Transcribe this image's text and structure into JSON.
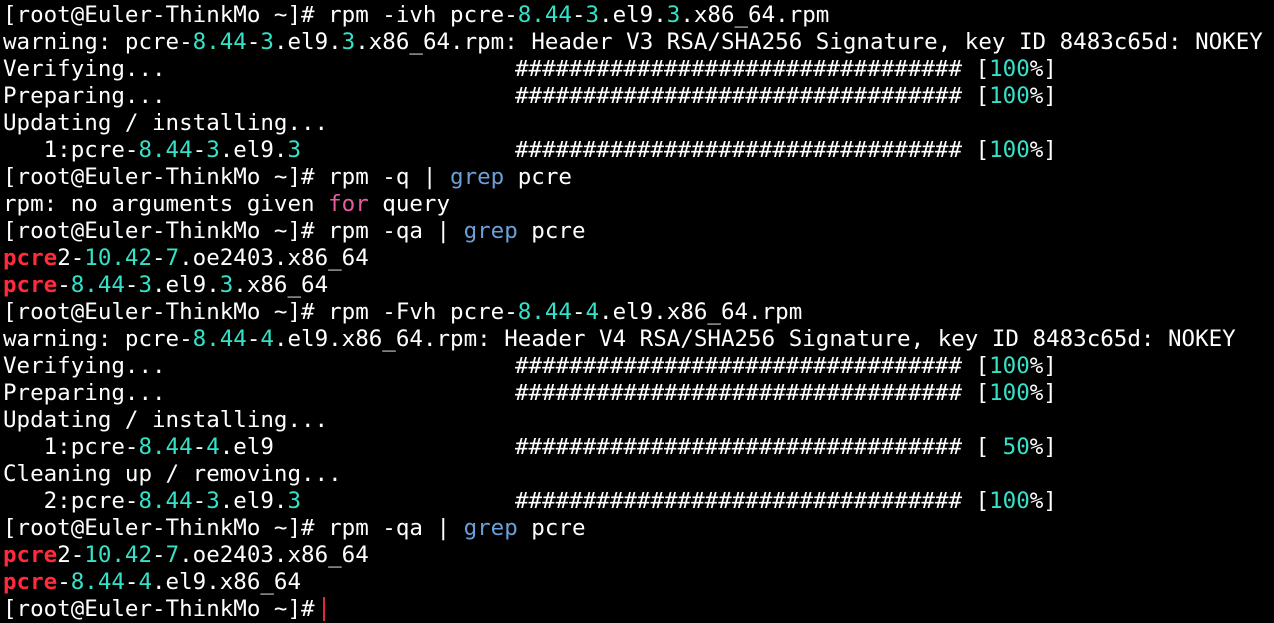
{
  "terminal": {
    "cursor_color": "#e3283e",
    "colors": {
      "text": "#ffffff",
      "number": "#34e2c8",
      "command": "#6c9fd8",
      "keyword": "#e85aa0",
      "match": "#ff2a3c",
      "background": "#000000"
    },
    "lines": [
      {
        "segs": [
          [
            "[root@Euler-ThinkMo ~]# rpm -ivh pcre-",
            "white"
          ],
          [
            "8.44",
            "num"
          ],
          [
            "-",
            "white"
          ],
          [
            "3",
            "num"
          ],
          [
            ".el9.",
            "white"
          ],
          [
            "3",
            "num"
          ],
          [
            ".x86_64.rpm",
            "white"
          ]
        ]
      },
      {
        "segs": [
          [
            "warning: pcre-",
            "white"
          ],
          [
            "8.44",
            "num"
          ],
          [
            "-",
            "white"
          ],
          [
            "3",
            "num"
          ],
          [
            ".el9.",
            "white"
          ],
          [
            "3",
            "num"
          ],
          [
            ".x86_64.rpm: Header V3 RSA/SHA256 Signature, key ID 8483c65d: NOKEY",
            "white"
          ]
        ]
      },
      {
        "segs": [
          [
            "Verifying...",
            "white"
          ]
        ],
        "right": [
          [
            "################################# [",
            "white"
          ],
          [
            "100",
            "num"
          ],
          [
            "%]",
            "white"
          ]
        ]
      },
      {
        "segs": [
          [
            "Preparing...",
            "white"
          ]
        ],
        "right": [
          [
            "################################# [",
            "white"
          ],
          [
            "100",
            "num"
          ],
          [
            "%]",
            "white"
          ]
        ]
      },
      {
        "segs": [
          [
            "Updating / installing...",
            "white"
          ]
        ]
      },
      {
        "segs": [
          [
            "   1:pcre-",
            "white"
          ],
          [
            "8.44",
            "num"
          ],
          [
            "-",
            "white"
          ],
          [
            "3",
            "num"
          ],
          [
            ".el9.",
            "white"
          ],
          [
            "3",
            "num"
          ]
        ],
        "right": [
          [
            "################################# [",
            "white"
          ],
          [
            "100",
            "num"
          ],
          [
            "%]",
            "white"
          ]
        ]
      },
      {
        "segs": [
          [
            "[root@Euler-ThinkMo ~]# rpm -q | ",
            "white"
          ],
          [
            "grep",
            "cmd"
          ],
          [
            " pcre",
            "white"
          ]
        ]
      },
      {
        "segs": [
          [
            "rpm: no arguments given ",
            "white"
          ],
          [
            "for",
            "kw"
          ],
          [
            " query",
            "white"
          ]
        ]
      },
      {
        "segs": [
          [
            "[root@Euler-ThinkMo ~]# rpm -qa | ",
            "white"
          ],
          [
            "grep",
            "cmd"
          ],
          [
            " pcre",
            "white"
          ]
        ]
      },
      {
        "segs": [
          [
            "pcre",
            "match"
          ],
          [
            "2-",
            "white"
          ],
          [
            "10.42",
            "num"
          ],
          [
            "-",
            "white"
          ],
          [
            "7",
            "num"
          ],
          [
            ".oe2403.x86_64",
            "white"
          ]
        ]
      },
      {
        "segs": [
          [
            "pcre",
            "match"
          ],
          [
            "-",
            "white"
          ],
          [
            "8.44",
            "num"
          ],
          [
            "-",
            "white"
          ],
          [
            "3",
            "num"
          ],
          [
            ".el9.",
            "white"
          ],
          [
            "3",
            "num"
          ],
          [
            ".x86_64",
            "white"
          ]
        ]
      },
      {
        "segs": [
          [
            "[root@Euler-ThinkMo ~]# rpm -Fvh pcre-",
            "white"
          ],
          [
            "8.44",
            "num"
          ],
          [
            "-",
            "white"
          ],
          [
            "4",
            "num"
          ],
          [
            ".el9.x86_64.rpm",
            "white"
          ]
        ]
      },
      {
        "segs": [
          [
            "warning: pcre-",
            "white"
          ],
          [
            "8.44",
            "num"
          ],
          [
            "-",
            "white"
          ],
          [
            "4",
            "num"
          ],
          [
            ".el9.x86_64.rpm: Header V4 RSA/SHA256 Signature, key ID 8483c65d: NOKEY",
            "white"
          ]
        ]
      },
      {
        "segs": [
          [
            "Verifying...",
            "white"
          ]
        ],
        "right": [
          [
            "################################# [",
            "white"
          ],
          [
            "100",
            "num"
          ],
          [
            "%]",
            "white"
          ]
        ]
      },
      {
        "segs": [
          [
            "Preparing...",
            "white"
          ]
        ],
        "right": [
          [
            "################################# [",
            "white"
          ],
          [
            "100",
            "num"
          ],
          [
            "%]",
            "white"
          ]
        ]
      },
      {
        "segs": [
          [
            "Updating / installing...",
            "white"
          ]
        ]
      },
      {
        "segs": [
          [
            "   1:pcre-",
            "white"
          ],
          [
            "8.44",
            "num"
          ],
          [
            "-",
            "white"
          ],
          [
            "4",
            "num"
          ],
          [
            ".el9",
            "white"
          ]
        ],
        "right": [
          [
            "################################# [ ",
            "white"
          ],
          [
            "50",
            "num"
          ],
          [
            "%]",
            "white"
          ]
        ]
      },
      {
        "segs": [
          [
            "Cleaning up / removing...",
            "white"
          ]
        ]
      },
      {
        "segs": [
          [
            "   2:pcre-",
            "white"
          ],
          [
            "8.44",
            "num"
          ],
          [
            "-",
            "white"
          ],
          [
            "3",
            "num"
          ],
          [
            ".el9.",
            "white"
          ],
          [
            "3",
            "num"
          ]
        ],
        "right": [
          [
            "################################# [",
            "white"
          ],
          [
            "100",
            "num"
          ],
          [
            "%]",
            "white"
          ]
        ]
      },
      {
        "segs": [
          [
            "[root@Euler-ThinkMo ~]# rpm -qa | ",
            "white"
          ],
          [
            "grep",
            "cmd"
          ],
          [
            " pcre",
            "white"
          ]
        ]
      },
      {
        "segs": [
          [
            "pcre",
            "match"
          ],
          [
            "2-",
            "white"
          ],
          [
            "10.42",
            "num"
          ],
          [
            "-",
            "white"
          ],
          [
            "7",
            "num"
          ],
          [
            ".oe2403.x86_64",
            "white"
          ]
        ]
      },
      {
        "segs": [
          [
            "pcre",
            "match"
          ],
          [
            "-",
            "white"
          ],
          [
            "8.44",
            "num"
          ],
          [
            "-",
            "white"
          ],
          [
            "4",
            "num"
          ],
          [
            ".el9.x86_64",
            "white"
          ]
        ]
      },
      {
        "segs": [
          [
            "[root@Euler-ThinkMo ~]#",
            "white"
          ]
        ],
        "cursor": true
      }
    ]
  }
}
